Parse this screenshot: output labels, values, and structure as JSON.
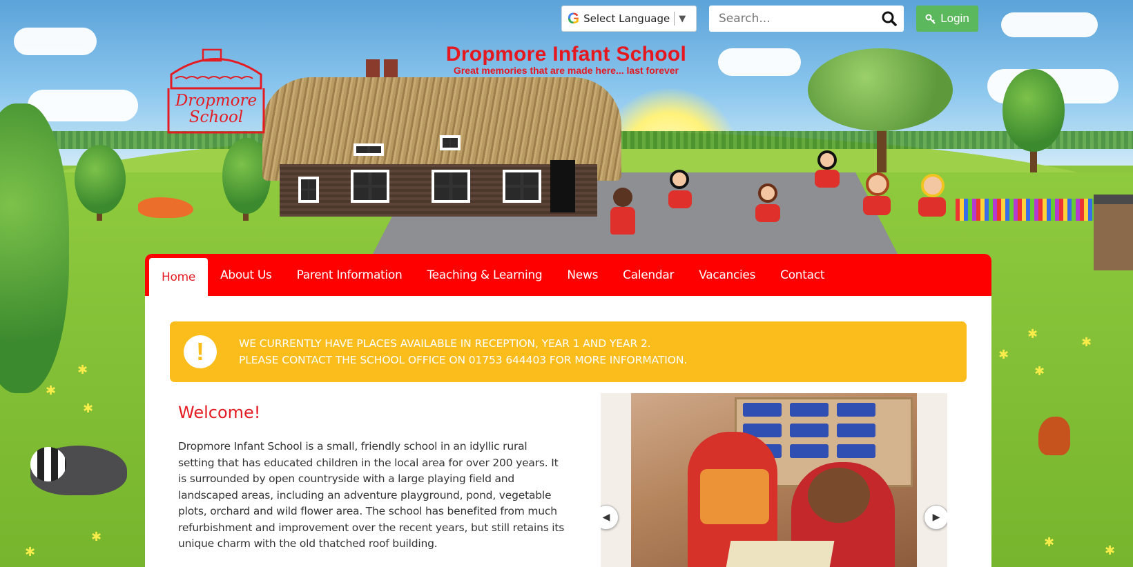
{
  "header": {
    "school_name": "Dropmore Infant School",
    "tagline": "Great memories that are made here... last forever",
    "logo_text": "Dropmore School",
    "logo_icon": "thatched-cottage-logo"
  },
  "utility": {
    "language_label": "Select Language",
    "language_icon": "google-g-icon",
    "search_placeholder": "Search...",
    "search_icon": "search-icon",
    "login_label": "Login",
    "login_icon": "key-icon"
  },
  "nav": {
    "items": [
      {
        "label": "Home",
        "active": true
      },
      {
        "label": "About Us"
      },
      {
        "label": "Parent Information"
      },
      {
        "label": "Teaching & Learning"
      },
      {
        "label": "News"
      },
      {
        "label": "Calendar"
      },
      {
        "label": "Vacancies"
      },
      {
        "label": "Contact"
      }
    ]
  },
  "alert": {
    "icon": "exclamation-icon",
    "line1": "WE CURRENTLY HAVE PLACES AVAILABLE IN RECEPTION, YEAR 1 AND YEAR 2.",
    "line2": "PLEASE CONTACT THE SCHOOL OFFICE ON 01753 644403 FOR MORE INFORMATION."
  },
  "welcome": {
    "heading": "Welcome!",
    "body": "Dropmore Infant School is a small, friendly school in an idyllic rural setting that has educated children in the local area for over 200 years. It is surrounded by open countryside with a large playing field and landscaped areas, including an adventure playground, pond, vegetable plots, orchard and wild flower area. The school has benefited from much refurbishment and improvement over the recent years, but still retains its unique charm with the old thatched roof building."
  },
  "slider": {
    "prev_icon": "chevron-left-icon",
    "next_icon": "chevron-right-icon"
  },
  "colors": {
    "brand_red": "#ff0000",
    "title_red": "#e5171f",
    "alert_yellow": "#fbbd1b",
    "login_green": "#5cb85c",
    "grass": "#8cc63f"
  }
}
